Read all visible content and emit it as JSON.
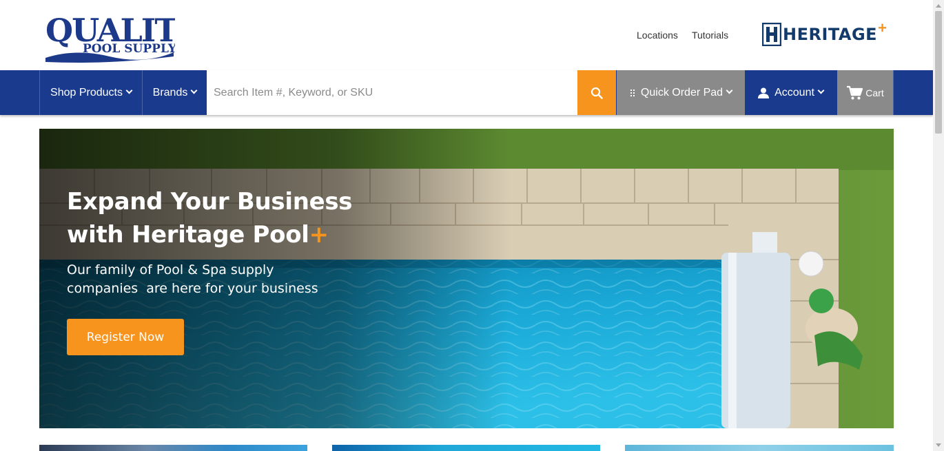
{
  "brand": {
    "logo_line1": "QUALITY",
    "logo_line2": "POOL SUPPLY",
    "partner_logo": "HERITAGE",
    "partner_plus": "+"
  },
  "top_links": [
    "Locations",
    "Tutorials"
  ],
  "nav": {
    "shop_products": "Shop Products",
    "brands": "Brands",
    "search_placeholder": "Search Item #, Keyword, or SKU",
    "quick_order": "Quick Order Pad",
    "account": "Account",
    "cart": "Cart"
  },
  "hero": {
    "title_line1": "Expand Your Business",
    "title_line2": "with Heritage Pool",
    "title_plus": "+",
    "subtitle_line1": "Our family of Pool & Spa supply",
    "subtitle_line2": "companies  are here for your business",
    "cta": "Register Now"
  },
  "colors": {
    "navy": "#1a3a8e",
    "orange": "#f7941d",
    "gray": "#8a8a8a"
  },
  "icons": [
    "search-icon",
    "grid-icon",
    "user-icon",
    "cart-icon",
    "chevron-down-icon"
  ]
}
